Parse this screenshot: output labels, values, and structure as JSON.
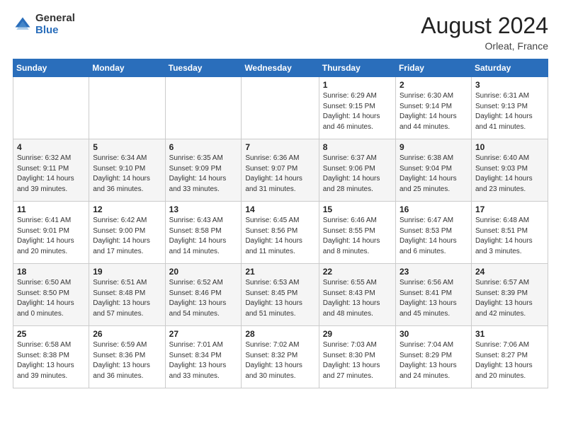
{
  "header": {
    "logo_general": "General",
    "logo_blue": "Blue",
    "month_year": "August 2024",
    "location": "Orleat, France"
  },
  "days_of_week": [
    "Sunday",
    "Monday",
    "Tuesday",
    "Wednesday",
    "Thursday",
    "Friday",
    "Saturday"
  ],
  "weeks": [
    [
      {
        "day": "",
        "info": ""
      },
      {
        "day": "",
        "info": ""
      },
      {
        "day": "",
        "info": ""
      },
      {
        "day": "",
        "info": ""
      },
      {
        "day": "1",
        "info": "Sunrise: 6:29 AM\nSunset: 9:15 PM\nDaylight: 14 hours\nand 46 minutes."
      },
      {
        "day": "2",
        "info": "Sunrise: 6:30 AM\nSunset: 9:14 PM\nDaylight: 14 hours\nand 44 minutes."
      },
      {
        "day": "3",
        "info": "Sunrise: 6:31 AM\nSunset: 9:13 PM\nDaylight: 14 hours\nand 41 minutes."
      }
    ],
    [
      {
        "day": "4",
        "info": "Sunrise: 6:32 AM\nSunset: 9:11 PM\nDaylight: 14 hours\nand 39 minutes."
      },
      {
        "day": "5",
        "info": "Sunrise: 6:34 AM\nSunset: 9:10 PM\nDaylight: 14 hours\nand 36 minutes."
      },
      {
        "day": "6",
        "info": "Sunrise: 6:35 AM\nSunset: 9:09 PM\nDaylight: 14 hours\nand 33 minutes."
      },
      {
        "day": "7",
        "info": "Sunrise: 6:36 AM\nSunset: 9:07 PM\nDaylight: 14 hours\nand 31 minutes."
      },
      {
        "day": "8",
        "info": "Sunrise: 6:37 AM\nSunset: 9:06 PM\nDaylight: 14 hours\nand 28 minutes."
      },
      {
        "day": "9",
        "info": "Sunrise: 6:38 AM\nSunset: 9:04 PM\nDaylight: 14 hours\nand 25 minutes."
      },
      {
        "day": "10",
        "info": "Sunrise: 6:40 AM\nSunset: 9:03 PM\nDaylight: 14 hours\nand 23 minutes."
      }
    ],
    [
      {
        "day": "11",
        "info": "Sunrise: 6:41 AM\nSunset: 9:01 PM\nDaylight: 14 hours\nand 20 minutes."
      },
      {
        "day": "12",
        "info": "Sunrise: 6:42 AM\nSunset: 9:00 PM\nDaylight: 14 hours\nand 17 minutes."
      },
      {
        "day": "13",
        "info": "Sunrise: 6:43 AM\nSunset: 8:58 PM\nDaylight: 14 hours\nand 14 minutes."
      },
      {
        "day": "14",
        "info": "Sunrise: 6:45 AM\nSunset: 8:56 PM\nDaylight: 14 hours\nand 11 minutes."
      },
      {
        "day": "15",
        "info": "Sunrise: 6:46 AM\nSunset: 8:55 PM\nDaylight: 14 hours\nand 8 minutes."
      },
      {
        "day": "16",
        "info": "Sunrise: 6:47 AM\nSunset: 8:53 PM\nDaylight: 14 hours\nand 6 minutes."
      },
      {
        "day": "17",
        "info": "Sunrise: 6:48 AM\nSunset: 8:51 PM\nDaylight: 14 hours\nand 3 minutes."
      }
    ],
    [
      {
        "day": "18",
        "info": "Sunrise: 6:50 AM\nSunset: 8:50 PM\nDaylight: 14 hours\nand 0 minutes."
      },
      {
        "day": "19",
        "info": "Sunrise: 6:51 AM\nSunset: 8:48 PM\nDaylight: 13 hours\nand 57 minutes."
      },
      {
        "day": "20",
        "info": "Sunrise: 6:52 AM\nSunset: 8:46 PM\nDaylight: 13 hours\nand 54 minutes."
      },
      {
        "day": "21",
        "info": "Sunrise: 6:53 AM\nSunset: 8:45 PM\nDaylight: 13 hours\nand 51 minutes."
      },
      {
        "day": "22",
        "info": "Sunrise: 6:55 AM\nSunset: 8:43 PM\nDaylight: 13 hours\nand 48 minutes."
      },
      {
        "day": "23",
        "info": "Sunrise: 6:56 AM\nSunset: 8:41 PM\nDaylight: 13 hours\nand 45 minutes."
      },
      {
        "day": "24",
        "info": "Sunrise: 6:57 AM\nSunset: 8:39 PM\nDaylight: 13 hours\nand 42 minutes."
      }
    ],
    [
      {
        "day": "25",
        "info": "Sunrise: 6:58 AM\nSunset: 8:38 PM\nDaylight: 13 hours\nand 39 minutes."
      },
      {
        "day": "26",
        "info": "Sunrise: 6:59 AM\nSunset: 8:36 PM\nDaylight: 13 hours\nand 36 minutes."
      },
      {
        "day": "27",
        "info": "Sunrise: 7:01 AM\nSunset: 8:34 PM\nDaylight: 13 hours\nand 33 minutes."
      },
      {
        "day": "28",
        "info": "Sunrise: 7:02 AM\nSunset: 8:32 PM\nDaylight: 13 hours\nand 30 minutes."
      },
      {
        "day": "29",
        "info": "Sunrise: 7:03 AM\nSunset: 8:30 PM\nDaylight: 13 hours\nand 27 minutes."
      },
      {
        "day": "30",
        "info": "Sunrise: 7:04 AM\nSunset: 8:29 PM\nDaylight: 13 hours\nand 24 minutes."
      },
      {
        "day": "31",
        "info": "Sunrise: 7:06 AM\nSunset: 8:27 PM\nDaylight: 13 hours\nand 20 minutes."
      }
    ]
  ]
}
